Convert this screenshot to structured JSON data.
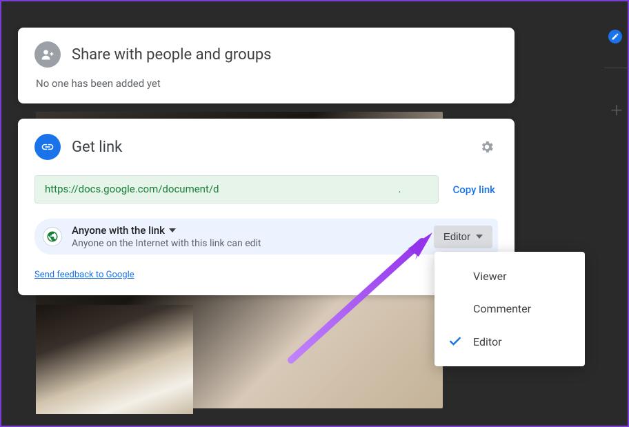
{
  "share_panel": {
    "title": "Share with people and groups",
    "status": "No one has been added yet"
  },
  "link_panel": {
    "title": "Get link",
    "url_prefix": "https://docs.google.com/document/d",
    "url_suffix": ".",
    "copy_label": "Copy link",
    "access": {
      "label": "Anyone with the link",
      "description": "Anyone on the Internet with this link can edit"
    },
    "role_selected": "Editor",
    "feedback_label": "Send feedback to Google"
  },
  "role_menu": {
    "options": [
      "Viewer",
      "Commenter",
      "Editor"
    ],
    "selected_index": 2
  },
  "colors": {
    "primary_blue": "#1a73e8",
    "green_text": "#188038",
    "arrow_purple": "#a855f7"
  }
}
